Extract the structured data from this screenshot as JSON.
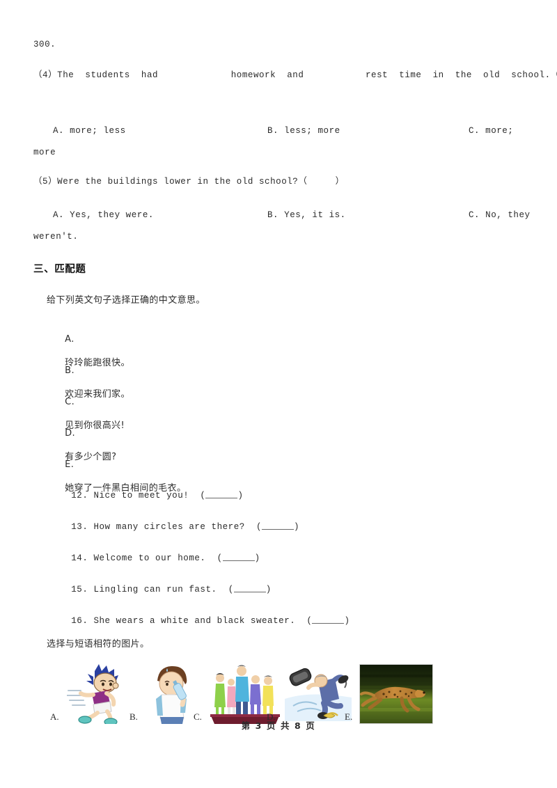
{
  "page": {
    "fragment_top": "300.",
    "footer": "第 3 页 共 8 页"
  },
  "reading_section": {
    "questions": [
      {
        "id": "q4",
        "stem": "（4）The  students  had             homework  and           rest  time  in  the  old  school.（      ）",
        "options": {
          "a": "A. more; less",
          "b": "B. less; more",
          "c": "C. more;",
          "c_wrap": "more"
        }
      },
      {
        "id": "q5",
        "stem": "（5）Were the buildings lower in the old school?（     ）",
        "options": {
          "a": "A. Yes, they were.",
          "b": "B. Yes, it is.",
          "c": "C. No, they",
          "c_wrap": "weren't."
        }
      }
    ]
  },
  "matching_section": {
    "heading": "三、匹配题",
    "instruction": "给下列英文句子选择正确的中文意思。",
    "choices": [
      {
        "letter": "A.",
        "text": "玲玲能跑很快。"
      },
      {
        "letter": "B.",
        "text": "欢迎来我们家。"
      },
      {
        "letter": "C.",
        "text": "见到你很高兴!"
      },
      {
        "letter": "D.",
        "text": "有多少个圆?"
      },
      {
        "letter": "E.",
        "text": "她穿了一件黑白相间的毛衣。"
      }
    ],
    "items": [
      {
        "number": "12",
        "sep": ".",
        "text": "Nice to meet you!",
        "answer": ""
      },
      {
        "number": "13",
        "sep": ".",
        "text": "How many circles are there?",
        "answer": ""
      },
      {
        "number": "14",
        "sep": ".",
        "text": "Welcome to our home.",
        "answer": ""
      },
      {
        "number": "15",
        "sep": ".",
        "text": "Lingling can run fast.",
        "answer": ""
      },
      {
        "number": "16",
        "sep": ".",
        "text": "She wears a white and black sweater.",
        "answer": ""
      }
    ]
  },
  "picture_section": {
    "instruction": "选择与短语相符的图片。",
    "pictures": [
      {
        "label": "A.",
        "icon": "running-boy-cartoon-image",
        "alt": "卡通男孩奔跑"
      },
      {
        "label": "B.",
        "icon": "boy-drinking-water-image",
        "alt": "男孩喝水"
      },
      {
        "label": "C.",
        "icon": "people-on-treadmill-image",
        "alt": "人们在跑步机上"
      },
      {
        "label": "D.",
        "icon": "man-slipping-falling-image",
        "alt": "男人滑倒"
      },
      {
        "label": "E.",
        "icon": "running-cheetah-photo",
        "alt": "奔跑的猎豹"
      }
    ]
  },
  "colors": {
    "page_background": "#ffffff",
    "text": "#2b2b2b",
    "heading": "#111111",
    "cheetah_bg_dark": "#16200c",
    "cheetah_grass": "#6d8a24",
    "cheetah_body": "#b4762c",
    "treadmill_base": "#6e1c2e",
    "boy_hair": "#2a3fa0",
    "boy_shirt": "#8e2f86",
    "water_blue": "#dff0fb"
  }
}
